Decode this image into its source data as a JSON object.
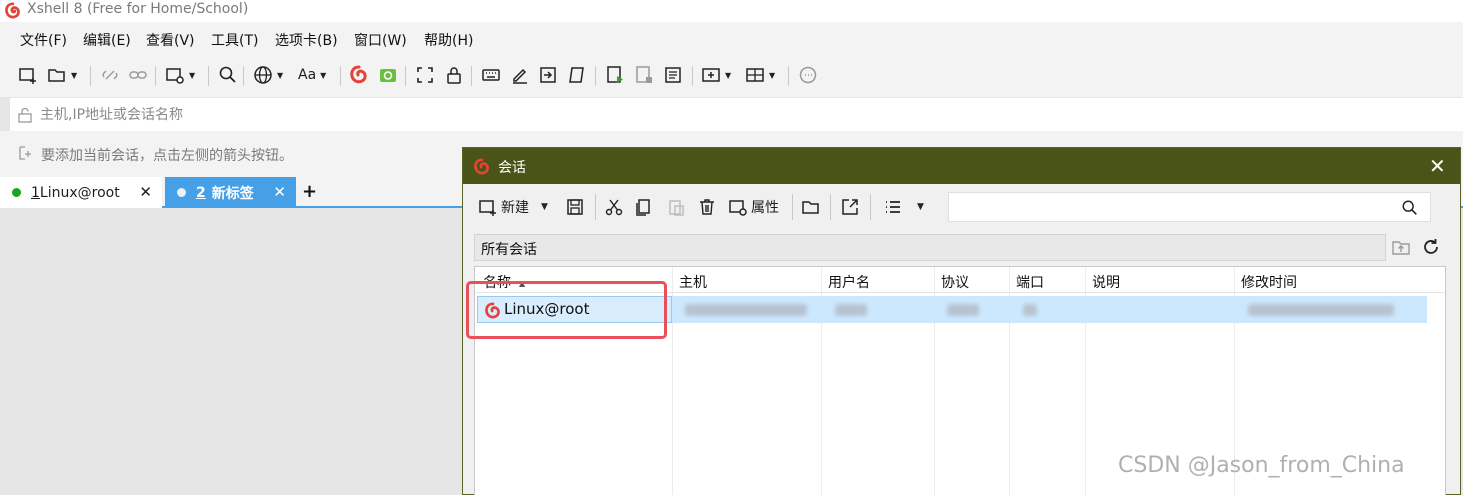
{
  "window": {
    "title": "Xshell 8 (Free for Home/School)"
  },
  "menu": [
    "文件(F)",
    "编辑(E)",
    "查看(V)",
    "工具(T)",
    "选项卡(B)",
    "窗口(W)",
    "帮助(H)"
  ],
  "toolbar": {
    "font_label": "Aa"
  },
  "address": {
    "placeholder": "主机,IP地址或会话名称"
  },
  "hint": {
    "text": "要添加当前会话，点击左侧的箭头按钮。"
  },
  "tabs": [
    {
      "number": "1",
      "label": "Linux@root",
      "status_color": "#1aa51a",
      "active": false
    },
    {
      "number": "2",
      "label": "新标签",
      "status_color": "#e8f1fb",
      "active": true
    }
  ],
  "dialog": {
    "title": "会话",
    "toolbar": {
      "new_label": "新建",
      "properties_label": "属性"
    },
    "search": {
      "value": ""
    },
    "path": "所有会话",
    "columns": [
      "名称",
      "主机",
      "用户名",
      "协议",
      "端口",
      "说明",
      "修改时间"
    ],
    "sort": {
      "column": "名称",
      "direction": "ascending",
      "indicator": "▲"
    },
    "sessions": [
      {
        "name": "Linux@root",
        "host_redacted": true,
        "user_redacted": true,
        "protocol_redacted": true,
        "port_redacted": true,
        "modified_redacted": true,
        "selected": true
      }
    ]
  },
  "watermark": "CSDN @Jason_from_China",
  "colors": {
    "accent": "#45a0e8",
    "dialog_titlebar": "#4b5418",
    "selection": "#cce8ff",
    "highlight_box": "#e8505b",
    "logo": "#e5433a"
  }
}
